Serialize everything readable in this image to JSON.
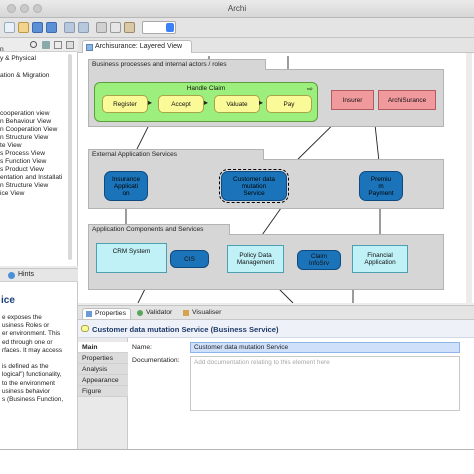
{
  "window": {
    "title": "Archi"
  },
  "model_tree": {
    "items": [
      "n",
      "y & Physical",
      "ation & Migration",
      "cooperation view",
      "n Behaviour View",
      "n Cooperation View",
      "n Structure View",
      "te View",
      "s Process View",
      "s Function View",
      "s Product View",
      "entation and Installati",
      "n Structure View",
      "ice View"
    ]
  },
  "hints": {
    "tab_label": "Hints",
    "heading": "ice",
    "lines": [
      "e exposes the",
      "usiness Roles or",
      "er environment. This",
      "ed through one or",
      "rfaces. It may access",
      "",
      "is defined as the",
      "logical\") functionality,",
      "to the environment",
      "usiness behavior",
      "s (Business Function,"
    ]
  },
  "editor": {
    "tab_label": "Archisurance: Layered View",
    "close_glyph": "⨯",
    "groups": {
      "business": "Business processes and internal actors / roles",
      "external": "External Application Services",
      "components": "Application Components and Services"
    },
    "nodes": {
      "handle_claim": "Handle Claim",
      "register": "Register",
      "accept": "Accept",
      "valuate": "Valuate",
      "pay": "Pay",
      "insurer": "Insurer",
      "archisurance": "ArchiSurance",
      "insurance_app": [
        "Insurance",
        "Applicati",
        "on"
      ],
      "cdm_service": [
        "Customer data",
        "mutation",
        "Service"
      ],
      "premium_payment": [
        "Premiu",
        "m",
        "Payment"
      ],
      "crm": "CRM System",
      "cis": "CIS",
      "policy": [
        "Policy Data",
        "Management"
      ],
      "claim_infosrv": [
        "Claim",
        "InfoSrv"
      ],
      "financial": [
        "Financial",
        "Application"
      ]
    }
  },
  "properties": {
    "tabs": [
      "Properties",
      "Validator",
      "Visualiser"
    ],
    "title": "Customer data mutation Service (Business Service)",
    "side_tabs": [
      "Main",
      "Properties",
      "Analysis",
      "Appearance",
      "Figure"
    ],
    "name_label": "Name:",
    "name_value": "Customer data mutation Service",
    "doc_label": "Documentation:",
    "doc_placeholder": "Add documentation relating to this element here"
  },
  "colors": {
    "business_process": "#fbfa98",
    "business_actor": "#f09a9e",
    "app_service": "#1b74b9",
    "app_component": "#bff1f6",
    "handle_claim_fill": "#9cef7c",
    "group_fill": "#d6d6d6",
    "selection": "#cfe0fb"
  }
}
